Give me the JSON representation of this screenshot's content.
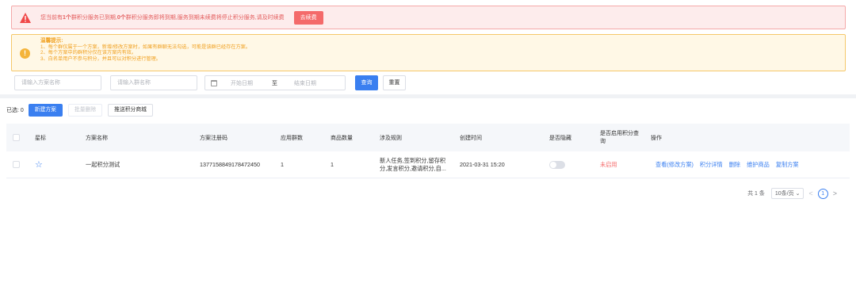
{
  "alert_error": {
    "text_prefix": "您当前有 ",
    "expired_count": "1个",
    "text_mid": "群积分服务已到期, ",
    "expiring_count": "0个",
    "text_suffix": "群积分服务即将到期,服务到期未续费将停止积分服务,请及时续费",
    "renew_label": "去续费"
  },
  "alert_warn": {
    "title": "温馨提示:",
    "lines": [
      "1、每个群仅属于一个方案，新增/修改方案时，如果有群聊无法勾选，可能是该群已经存在方案。",
      "2、每个方案中的群积分仅在该方案内有效。",
      "3、白名单用户不参与积分，并且可以对积分进行管理。"
    ]
  },
  "filters": {
    "plan_placeholder": "请输入方案名称",
    "group_placeholder": "请输入群名称",
    "start_date_placeholder": "开始日期",
    "date_separator": "至",
    "end_date_placeholder": "结束日期",
    "search_label": "查询",
    "reset_label": "重置"
  },
  "toolbar": {
    "selected_label": "已选: 0",
    "new_plan_label": "新建方案",
    "batch_delete_label": "批量删除",
    "push_mall_label": "推送积分商城"
  },
  "table": {
    "headers": {
      "star": "星标",
      "name": "方案名称",
      "reg_code": "方案注册码",
      "groups": "应用群数",
      "goods": "商品数量",
      "rules": "涉及规则",
      "created": "创建时间",
      "hidden": "是否隐藏",
      "query_line1": "是否启用积分查",
      "query_line2": "询",
      "actions": "操作"
    },
    "rows": [
      {
        "name": "一起积分测试",
        "reg_code": "1377158849178472450",
        "groups": "1",
        "goods": "1",
        "rules_line1": "新人任务,签到积分,留存积",
        "rules_line2": "分,发言积分,邀请积分,自...",
        "created": "2021-03-31 15:20",
        "query_status": "未启用",
        "actions": [
          "查看(修改方案)",
          "积分详情",
          "删除",
          "维护商品",
          "复制方案"
        ]
      }
    ]
  },
  "pager": {
    "total": "共 1 条",
    "page_size": "10条/页",
    "current_page": "1"
  },
  "colors": {
    "primary": "#3a7ff0",
    "danger": "#f56c6c",
    "warning": "#f4b43b"
  }
}
